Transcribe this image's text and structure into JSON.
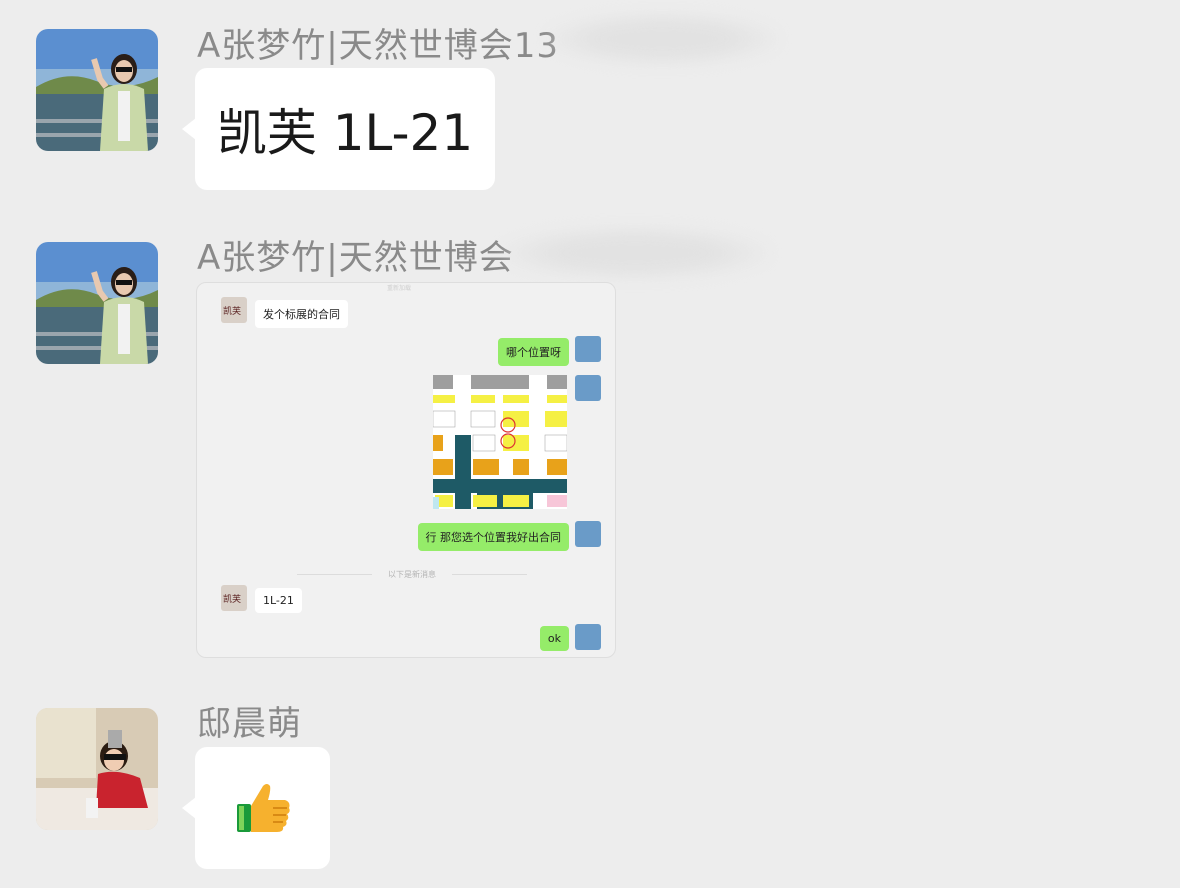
{
  "messages": [
    {
      "sender": "A张梦竹|天然世博会13",
      "text": "凯芙 1L-21"
    },
    {
      "sender": "A张梦竹|天然世博会",
      "type": "image"
    },
    {
      "sender": "邸晨萌",
      "type": "emoji",
      "emoji": "thumbs-up"
    }
  ],
  "embedded_chat": {
    "top_text": "重新加载",
    "avatar_text": "凯芙",
    "items": [
      {
        "side": "in",
        "text": "发个标展的合同"
      },
      {
        "side": "out",
        "text": "哪个位置呀"
      },
      {
        "side": "out",
        "type": "floor-plan-image"
      },
      {
        "side": "out",
        "text": "行 那您选个位置我好出合同"
      },
      {
        "side": "in",
        "text": "1L-21"
      },
      {
        "side": "out",
        "text": "ok"
      }
    ],
    "divider_text": "以下是新消息"
  },
  "colors": {
    "background": "#ededed",
    "bubble_in": "#ffffff",
    "bubble_out": "#95ec69",
    "sender_name": "#8a8a8a"
  }
}
